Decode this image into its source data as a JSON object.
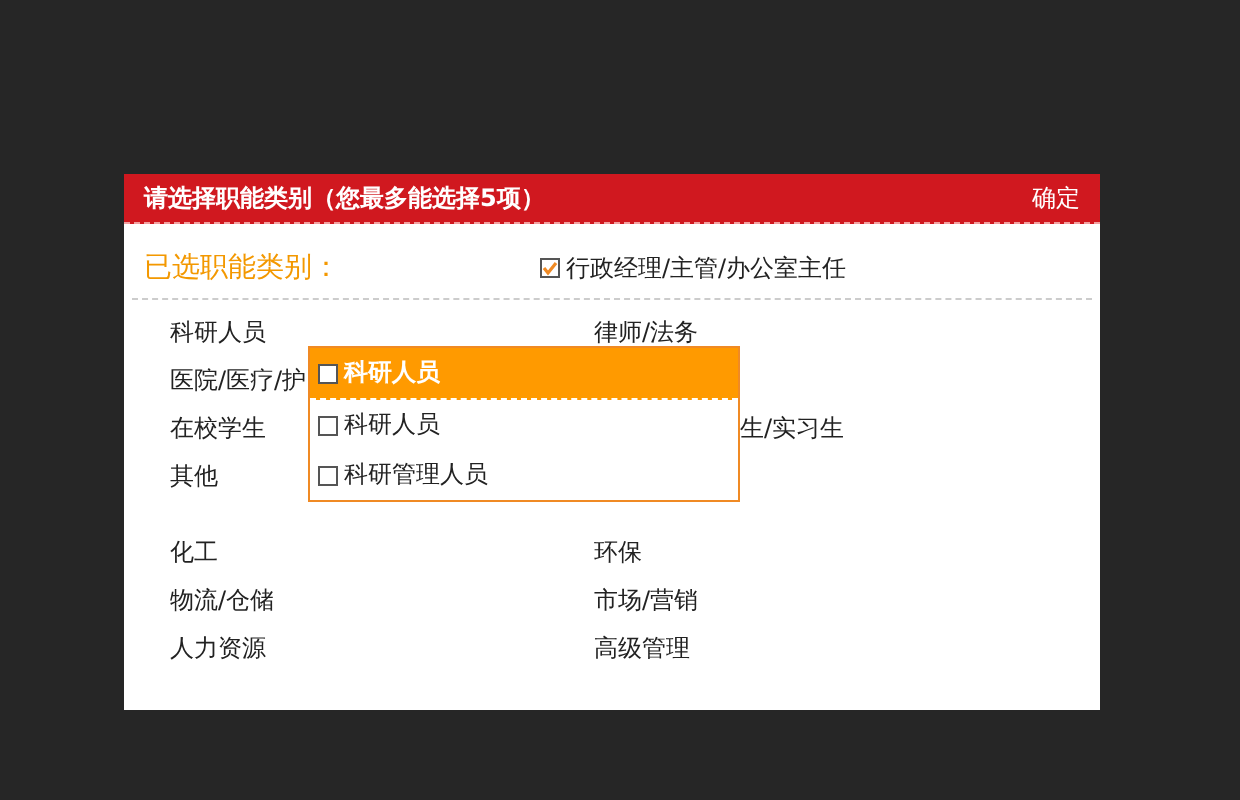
{
  "dialog": {
    "title": "请选择职能类别（您最多能选择5项）",
    "confirm": "确定"
  },
  "selected": {
    "label": "已选职能类别：",
    "items": [
      {
        "text": "行政经理/主管/办公室主任",
        "checked": true
      }
    ]
  },
  "categories": [
    {
      "left": {
        "text": "科研人员"
      },
      "right": {
        "text": "律师/法务"
      }
    },
    {
      "left": {
        "text": "医院/医疗/护"
      }
    },
    {
      "left": {
        "text": "在校学生"
      },
      "right": {
        "text": "生/实习生",
        "kind": "overlapped"
      }
    },
    {
      "left": {
        "text": "其他"
      }
    },
    {
      "left": {
        "text": "化工"
      },
      "right": {
        "text": "环保"
      }
    },
    {
      "left": {
        "text": "物流/仓储"
      },
      "right": {
        "text": "市场/营销"
      }
    },
    {
      "left": {
        "text": "人力资源"
      },
      "right": {
        "text": "高级管理"
      }
    }
  ],
  "popup": {
    "items": [
      {
        "text": "科研人员",
        "checked": false,
        "selected": true
      },
      {
        "text": "科研人员",
        "checked": false,
        "selected": false
      },
      {
        "text": "科研管理人员",
        "checked": false,
        "selected": false
      }
    ]
  }
}
